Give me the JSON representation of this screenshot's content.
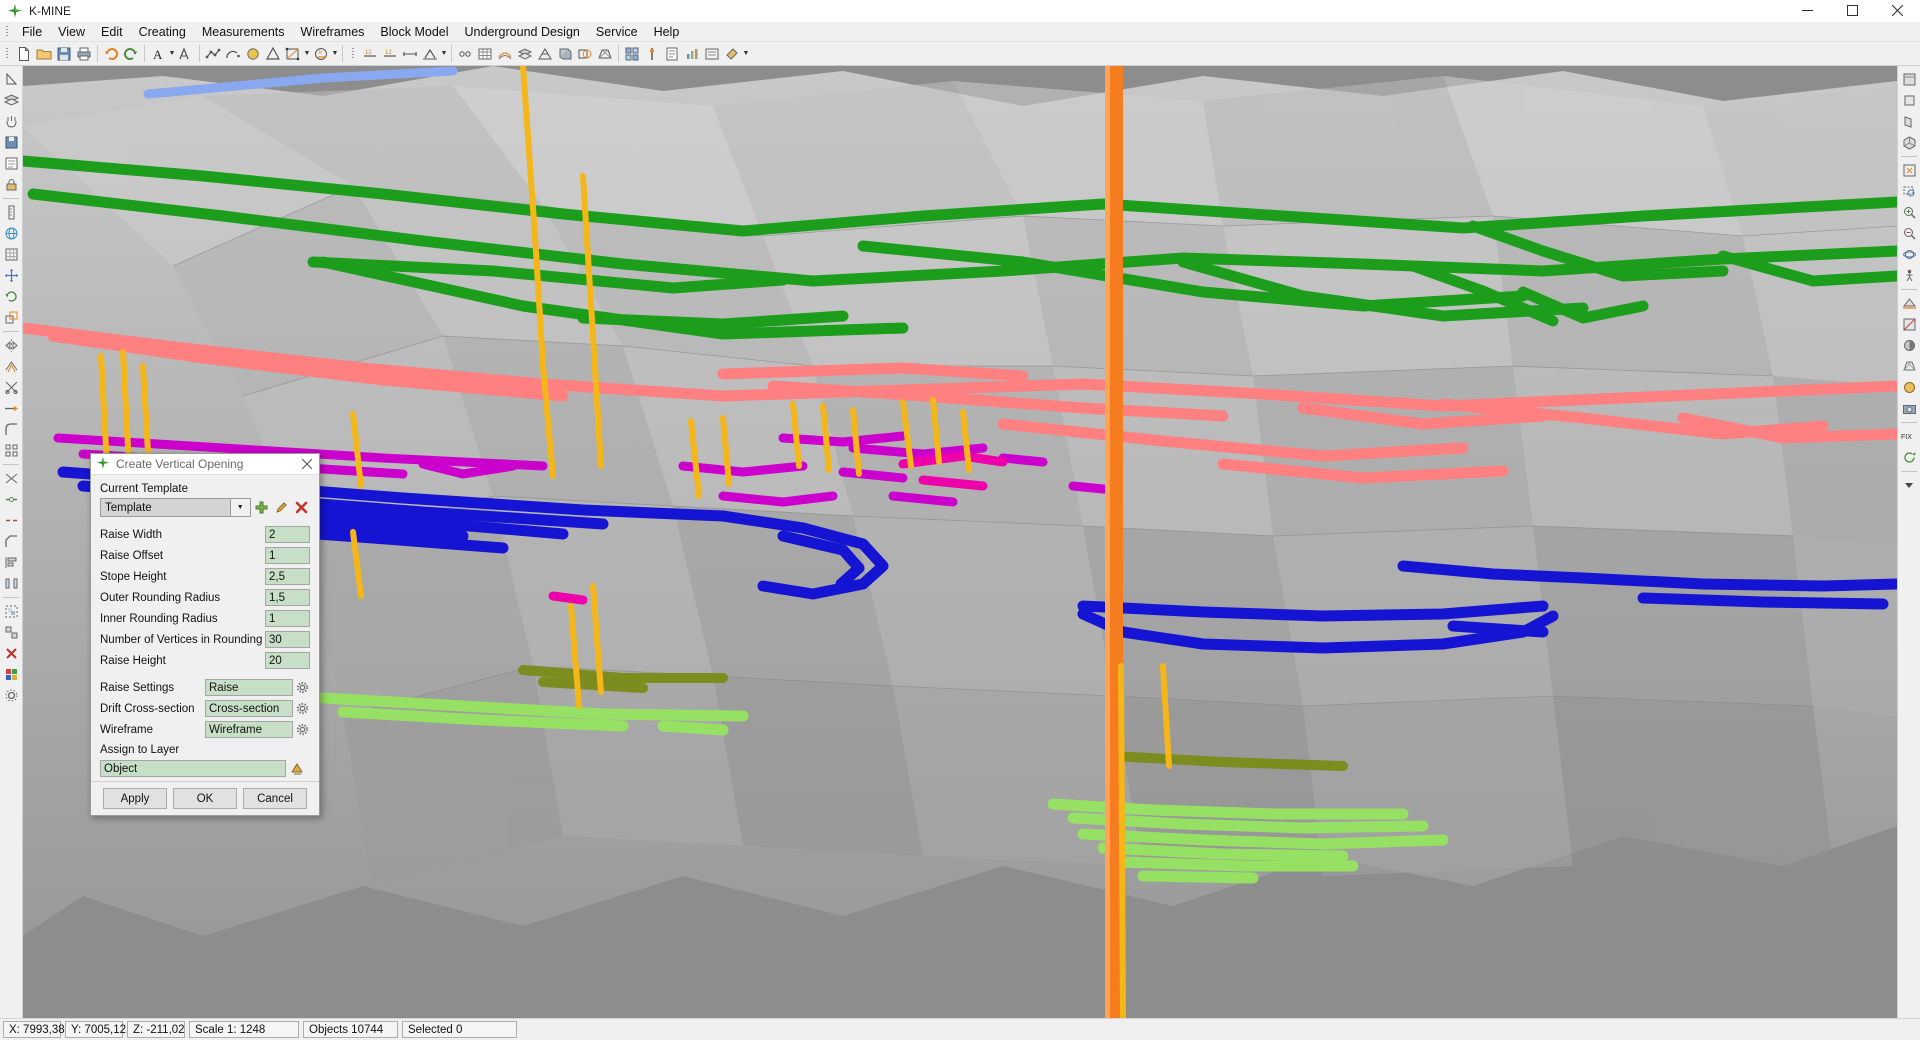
{
  "window": {
    "title": "K-MINE",
    "logo_icon": "four-point-star-icon",
    "minimize_label": "—",
    "maximize_label": "❐",
    "close_label": "✕"
  },
  "menubar": {
    "items": [
      {
        "label": "File"
      },
      {
        "label": "View"
      },
      {
        "label": "Edit"
      },
      {
        "label": "Creating"
      },
      {
        "label": "Measurements"
      },
      {
        "label": "Wireframes"
      },
      {
        "label": "Block Model"
      },
      {
        "label": "Underground Design"
      },
      {
        "label": "Service"
      },
      {
        "label": "Help"
      }
    ]
  },
  "toolbar": {
    "groups": [
      {
        "tools": [
          {
            "name": "new-file-icon"
          },
          {
            "name": "open-folder-icon"
          },
          {
            "name": "save-icon"
          },
          {
            "name": "print-icon"
          },
          {
            "name": "undo-icon"
          },
          {
            "name": "redo-icon"
          },
          {
            "name": "text-icon",
            "caret": true
          },
          {
            "name": "font-icon"
          }
        ]
      },
      {
        "tools": [
          {
            "name": "polyline-icon"
          },
          {
            "name": "arc-icon"
          },
          {
            "name": "circle-icon"
          },
          {
            "name": "polygon-icon"
          },
          {
            "name": "point-icon",
            "caret": true
          },
          {
            "name": "rectangle-icon",
            "caret": true
          },
          {
            "name": "spline-icon"
          },
          {
            "name": "shape-icon",
            "caret": true
          }
        ]
      },
      {
        "tools": [
          {
            "name": "measure-distance-icon"
          },
          {
            "name": "measure-angle-icon"
          },
          {
            "name": "measure-area-icon"
          },
          {
            "name": "annotate-icon",
            "caret": true
          }
        ]
      },
      {
        "tools": [
          {
            "name": "section-icon"
          },
          {
            "name": "grid-icon"
          },
          {
            "name": "contour-icon"
          },
          {
            "name": "surface-icon"
          },
          {
            "name": "triangulate-icon"
          },
          {
            "name": "solid-icon"
          },
          {
            "name": "boolean-icon"
          },
          {
            "name": "wireframe-icon"
          }
        ]
      },
      {
        "tools": [
          {
            "name": "block-model-icon"
          },
          {
            "name": "drillhole-icon"
          },
          {
            "name": "report-icon"
          },
          {
            "name": "chart-icon"
          },
          {
            "name": "legend-icon"
          },
          {
            "name": "colorize-icon",
            "caret": true
          }
        ]
      }
    ]
  },
  "left_toolbar": {
    "tools": [
      {
        "name": "select-arrow-icon"
      },
      {
        "name": "layers-icon"
      },
      {
        "name": "pan-icon"
      },
      {
        "name": "save-view-icon"
      },
      {
        "name": "properties-icon"
      },
      {
        "name": "lock-icon"
      },
      {
        "name": "ruler-vertical-icon"
      },
      {
        "name": "globe-icon"
      },
      {
        "name": "grid-snap-icon"
      },
      {
        "name": "move-icon"
      },
      {
        "name": "rotate-icon"
      },
      {
        "name": "scale-icon"
      },
      {
        "name": "mirror-icon"
      },
      {
        "name": "offset-icon"
      },
      {
        "name": "trim-icon"
      },
      {
        "name": "extend-icon"
      },
      {
        "name": "fillet-icon"
      },
      {
        "name": "array-icon"
      },
      {
        "name": "explode-icon"
      },
      {
        "name": "join-icon"
      },
      {
        "name": "break-icon"
      },
      {
        "name": "chamfer-icon"
      },
      {
        "name": "align-icon"
      },
      {
        "name": "distribute-icon"
      },
      {
        "name": "group-icon"
      },
      {
        "name": "ungroup-icon"
      },
      {
        "name": "delete-icon"
      },
      {
        "name": "color-picker-icon"
      },
      {
        "name": "settings-icon"
      }
    ]
  },
  "right_toolbar": {
    "tools": [
      {
        "name": "view-top-icon"
      },
      {
        "name": "view-front-icon"
      },
      {
        "name": "view-side-icon"
      },
      {
        "name": "view-iso-icon"
      },
      {
        "name": "zoom-extents-icon"
      },
      {
        "name": "zoom-window-icon"
      },
      {
        "name": "zoom-in-icon"
      },
      {
        "name": "zoom-out-icon"
      },
      {
        "name": "orbit-icon"
      },
      {
        "name": "walk-icon"
      },
      {
        "name": "clip-plane-icon"
      },
      {
        "name": "section-view-icon"
      },
      {
        "name": "shade-icon"
      },
      {
        "name": "wireframe-view-icon"
      },
      {
        "name": "render-icon"
      },
      {
        "name": "camera-icon"
      },
      {
        "name": "fix-view-icon"
      },
      {
        "name": "refresh-icon"
      }
    ],
    "fix_label": "FIX"
  },
  "dialog": {
    "title": "Create Vertical Opening",
    "title_icon": "four-point-star-icon",
    "close_icon": "close-icon",
    "current_template_label": "Current Template",
    "template_value": "Template",
    "template_buttons": [
      {
        "name": "add-template-button",
        "icon": "plus-green-icon"
      },
      {
        "name": "edit-template-button",
        "icon": "pencil-icon"
      },
      {
        "name": "delete-template-button",
        "icon": "delete-red-icon"
      }
    ],
    "numeric_fields": [
      {
        "label": "Raise Width",
        "value": "2",
        "name": "raise-width"
      },
      {
        "label": "Raise Offset",
        "value": "1",
        "name": "raise-offset"
      },
      {
        "label": "Stope Height",
        "value": "2,5",
        "name": "stope-height"
      },
      {
        "label": "Outer Rounding Radius",
        "value": "1,5",
        "name": "outer-rounding-radius"
      },
      {
        "label": "Inner Rounding Radius",
        "value": "1",
        "name": "inner-rounding-radius"
      },
      {
        "label": "Number of Vertices in Rounding",
        "value": "30",
        "name": "vertices-in-rounding"
      },
      {
        "label": "Raise Height",
        "value": "20",
        "name": "raise-height"
      }
    ],
    "picker_fields": [
      {
        "label": "Raise Settings",
        "value": "Raise",
        "name": "raise-settings"
      },
      {
        "label": "Drift Cross-section",
        "value": "Cross-section",
        "name": "drift-cross-section"
      },
      {
        "label": "Wireframe",
        "value": "Wireframe",
        "name": "wireframe"
      }
    ],
    "assign_to_layer_label": "Assign to Layer",
    "assign_to_layer_value": "Object",
    "layer_button_icon": "layer-pick-icon",
    "buttons": [
      {
        "label": "Apply",
        "name": "apply-button"
      },
      {
        "label": "OK",
        "name": "ok-button"
      },
      {
        "label": "Cancel",
        "name": "cancel-button"
      }
    ]
  },
  "statusbar": {
    "cells": [
      {
        "name": "coord-x",
        "text": "X: 7993,38"
      },
      {
        "name": "coord-y",
        "text": "Y: 7005,12"
      },
      {
        "name": "coord-z",
        "text": "Z: -211,02"
      },
      {
        "name": "scale",
        "text": "Scale 1: 1248"
      },
      {
        "name": "objects-count",
        "text": "Objects 10744"
      },
      {
        "name": "selected-count",
        "text": "Selected 0"
      }
    ]
  },
  "colors": {
    "accent_green": "#3d8b37",
    "drift_green": "#1c9e1c",
    "drift_salmon": "#ff8080",
    "drift_blue": "#1414d2",
    "drift_magenta": "#cc00cc",
    "drift_pink": "#ee00aa",
    "drift_lightgreen": "#96e064",
    "drift_olive": "#7d8c1e",
    "raise_orange": "#f57c1f",
    "raise_yellow": "#f5b61a",
    "terrain_gray": "#b8b8b8",
    "viewport_bg": "#8d8d8d",
    "input_green": "#c6dfc6"
  }
}
